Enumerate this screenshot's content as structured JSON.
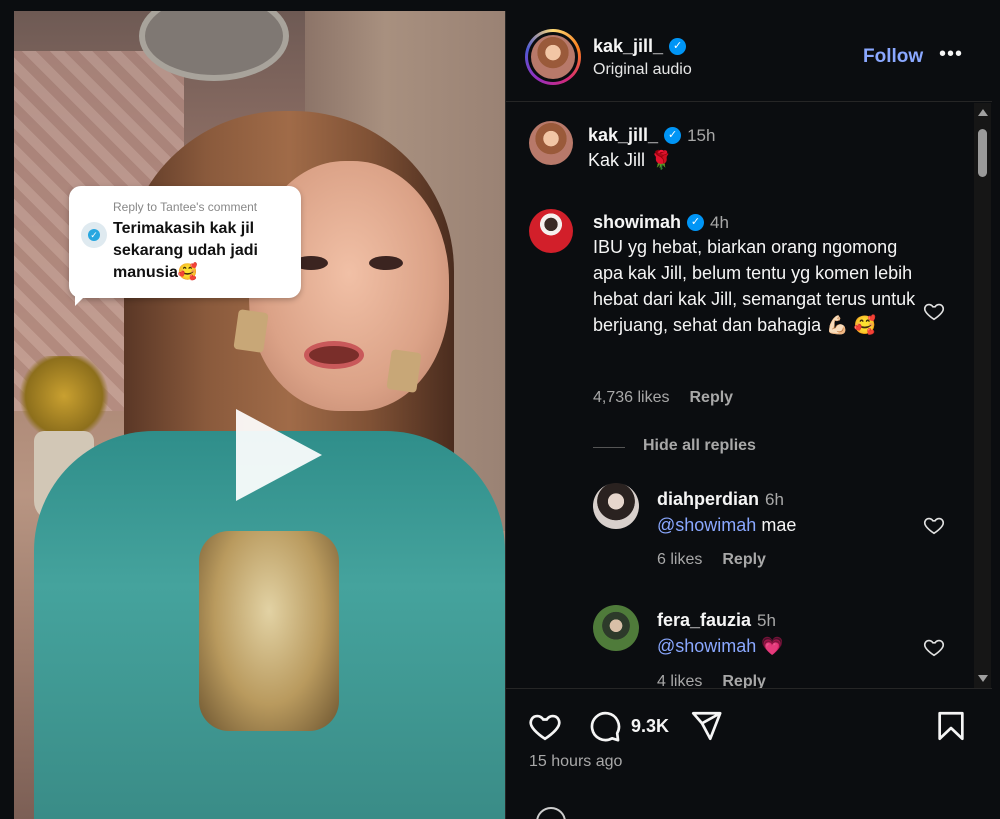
{
  "video": {
    "sticker": {
      "reply_label": "Reply to Tantee's comment",
      "text": "Terimakasih kak jil sekarang udah jadi manusia🥰"
    }
  },
  "header": {
    "username": "kak_jill_",
    "subtitle": "Original audio",
    "follow_label": "Follow",
    "more_label": "•••"
  },
  "caption": {
    "username": "kak_jill_",
    "time": "15h",
    "text": "Kak Jill 🌹"
  },
  "comments": [
    {
      "username": "showimah",
      "time": "4h",
      "text": "IBU yg hebat, biarkan orang ngomong apa kak Jill, belum tentu yg komen lebih hebat dari kak Jill, semangat terus untuk berjuang, sehat dan bahagia 💪🏻 🥰",
      "likes": "4,736 likes",
      "reply_label": "Reply",
      "hide_replies_label": "Hide all replies",
      "replies": [
        {
          "username": "diahperdian",
          "time": "6h",
          "mention": "@showimah",
          "text": "mae",
          "likes": "6 likes",
          "reply_label": "Reply"
        },
        {
          "username": "fera_fauzia",
          "time": "5h",
          "mention": "@showimah",
          "text": "💗",
          "likes": "4 likes",
          "reply_label": "Reply"
        }
      ]
    }
  ],
  "actions": {
    "comment_count": "9.3K",
    "time_ago": "15 hours ago"
  },
  "colors": {
    "accent": "#8aa8ff",
    "verified": "#0095f6",
    "background": "#0b0d10"
  },
  "icons": [
    "verified-icon",
    "heart-icon",
    "comment-icon",
    "share-icon",
    "bookmark-icon",
    "play-icon",
    "more-icon"
  ]
}
